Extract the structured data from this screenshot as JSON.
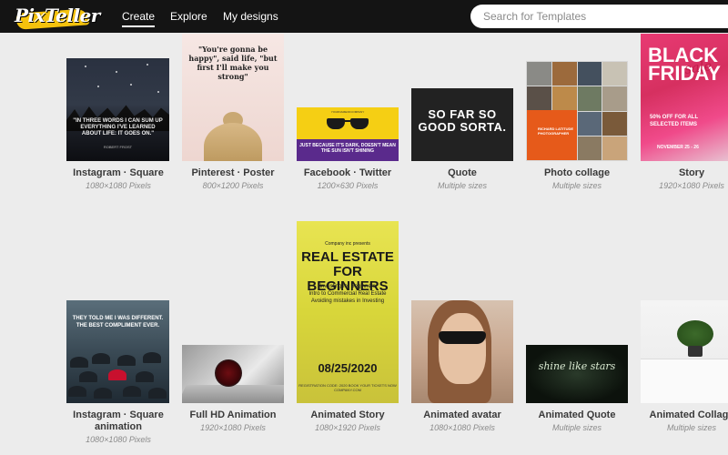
{
  "header": {
    "logo": "PixTeller",
    "nav": [
      "Create",
      "Explore",
      "My designs"
    ],
    "search_placeholder": "Search for Templates"
  },
  "cards": [
    {
      "title": "Instagram · Square",
      "sub": "1080×1080 Pixels",
      "preview_text": [
        "\"IN THREE WORDS I CAN SUM UP EVERYTHING I'VE LEARNED ABOUT LIFE: IT GOES ON.\"",
        "ROBERT FROST"
      ]
    },
    {
      "title": "Pinterest · Poster",
      "sub": "800×1200 Pixels",
      "preview_text": [
        "\"You're gonna be happy\", said life, \"but first I'll make you strong\""
      ]
    },
    {
      "title": "Facebook · Twitter",
      "sub": "1200×630 Pixels",
      "preview_text": [
        "YOURNAMEOFCOMPANY",
        "JUST BECAUSE IT'S DARK, DOESN'T MEAN THE SUN ISN'T SHINING"
      ]
    },
    {
      "title": "Quote",
      "sub": "Multiple sizes",
      "preview_text": [
        "SO FAR SO GOOD SORTA."
      ]
    },
    {
      "title": "Photo collage",
      "sub": "Multiple sizes",
      "preview_text": [
        "RICHARD LATITUDE PHOTOGRAPHER"
      ]
    },
    {
      "title": "Story",
      "sub": "1920×1080 Pixels",
      "preview_text": [
        "BLACK",
        "FRIDAY",
        "sale",
        "50% OFF FOR ALL SELECTED ITEMS",
        "NOVEMBER 25 - 26"
      ]
    },
    {
      "title": "Instagram · Square animation",
      "sub": "1080×1080 Pixels",
      "preview_text": [
        "THEY TOLD ME I WAS DIFFERENT. THE BEST COMPLIMENT EVER."
      ]
    },
    {
      "title": "Full HD Animation",
      "sub": "1920×1080 Pixels"
    },
    {
      "title": "Animated Story",
      "sub": "1080×1920 Pixels",
      "preview_text": [
        "Company inc presents",
        "REAL ESTATE FOR BEGINNERS",
        "Investing for Beginners",
        "Intro to Commercial Real Estate",
        "Avoiding mistakes in Investing",
        "08/25/2020",
        "REGISTRATION CODE: 2020 BOOK YOUR TICKETS NOW COMPANY.COM"
      ]
    },
    {
      "title": "Animated avatar",
      "sub": "1080×1080 Pixels"
    },
    {
      "title": "Animated Quote",
      "sub": "Multiple sizes",
      "preview_text": [
        "shine like stars"
      ]
    },
    {
      "title": "Animated Collage",
      "sub": "Multiple sizes"
    }
  ]
}
